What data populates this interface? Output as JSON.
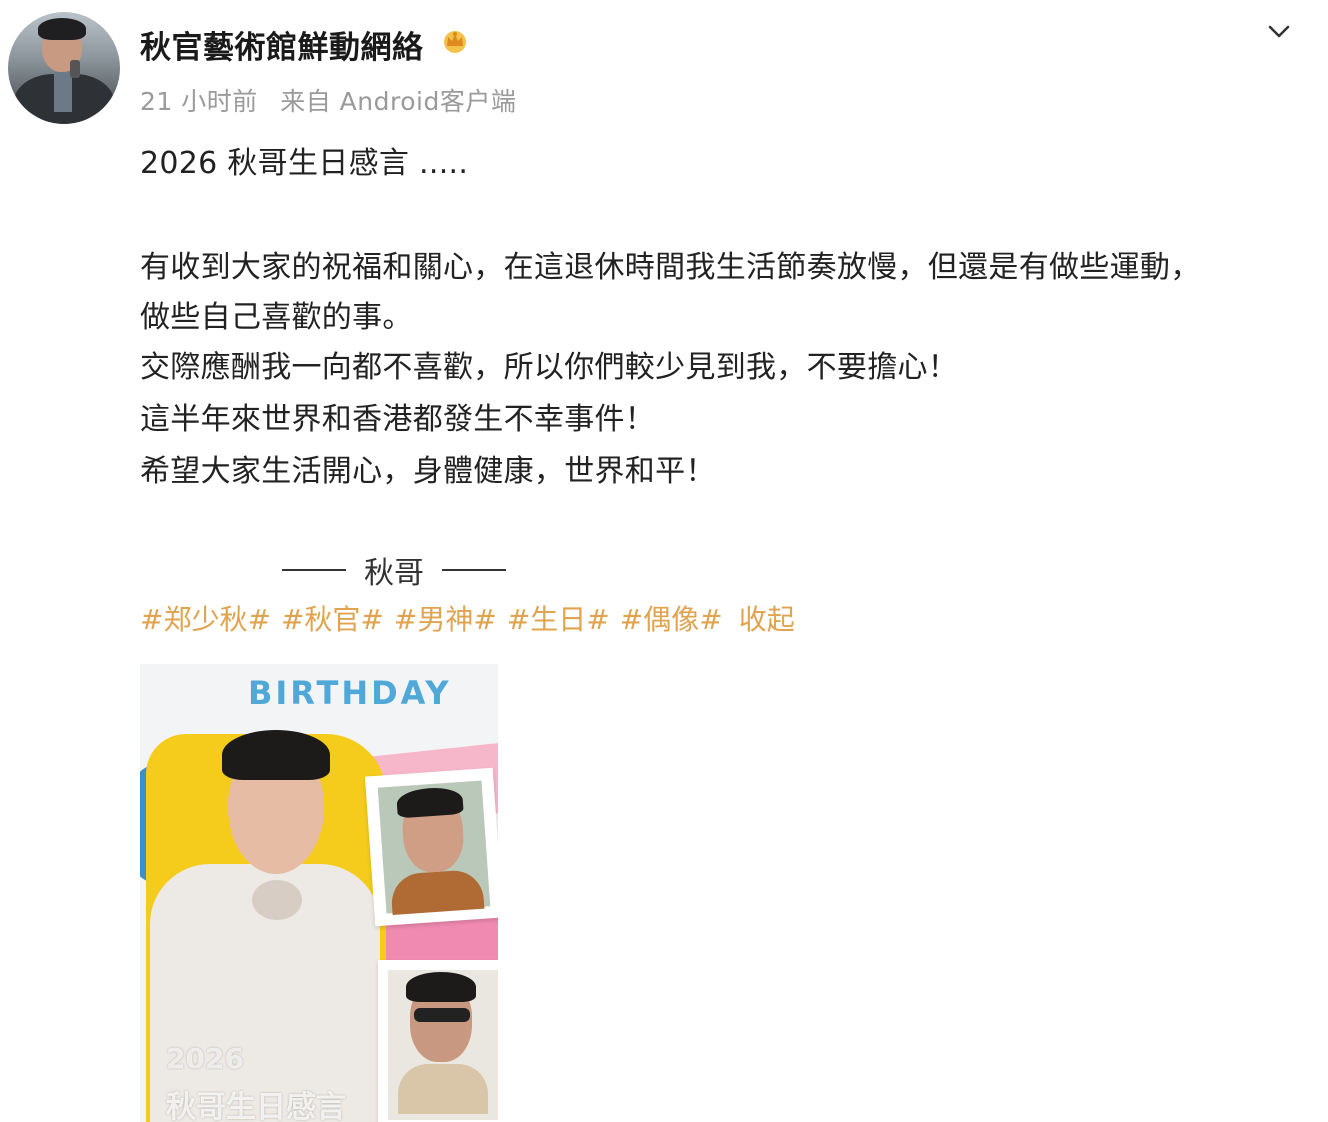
{
  "post": {
    "username": "秋官藝術館鮮動網絡",
    "time": "21 小时前",
    "source": "来自 Android客户端",
    "title_line": "2026 秋哥生日感言 .....",
    "body_lines": [
      "有收到大家的祝福和關心，在這退休時間我生活節奏放慢，但還是有做些運動，",
      "做些自己喜歡的事。",
      "交際應酬我一向都不喜歡，所以你們較少見到我，不要擔心！",
      "這半年來世界和香港都發生不幸事件！",
      "希望大家生活開心，身體健康，世界和平！"
    ],
    "signature": "秋哥",
    "tags": [
      "#郑少秋#",
      "#秋官#",
      "#男神#",
      "#生日#",
      "#偶像#"
    ],
    "collapse_label": "收起"
  },
  "image": {
    "header_text": "BIRTHDAY",
    "caption_year": "2026",
    "caption_text": "秋哥生日感言"
  },
  "icons": {
    "crown": "crown-icon",
    "menu": "chevron-down-icon"
  },
  "colors": {
    "tag": "#e0a34f",
    "meta": "#9a9a9a",
    "birthday_blue": "#4fa8d8"
  }
}
